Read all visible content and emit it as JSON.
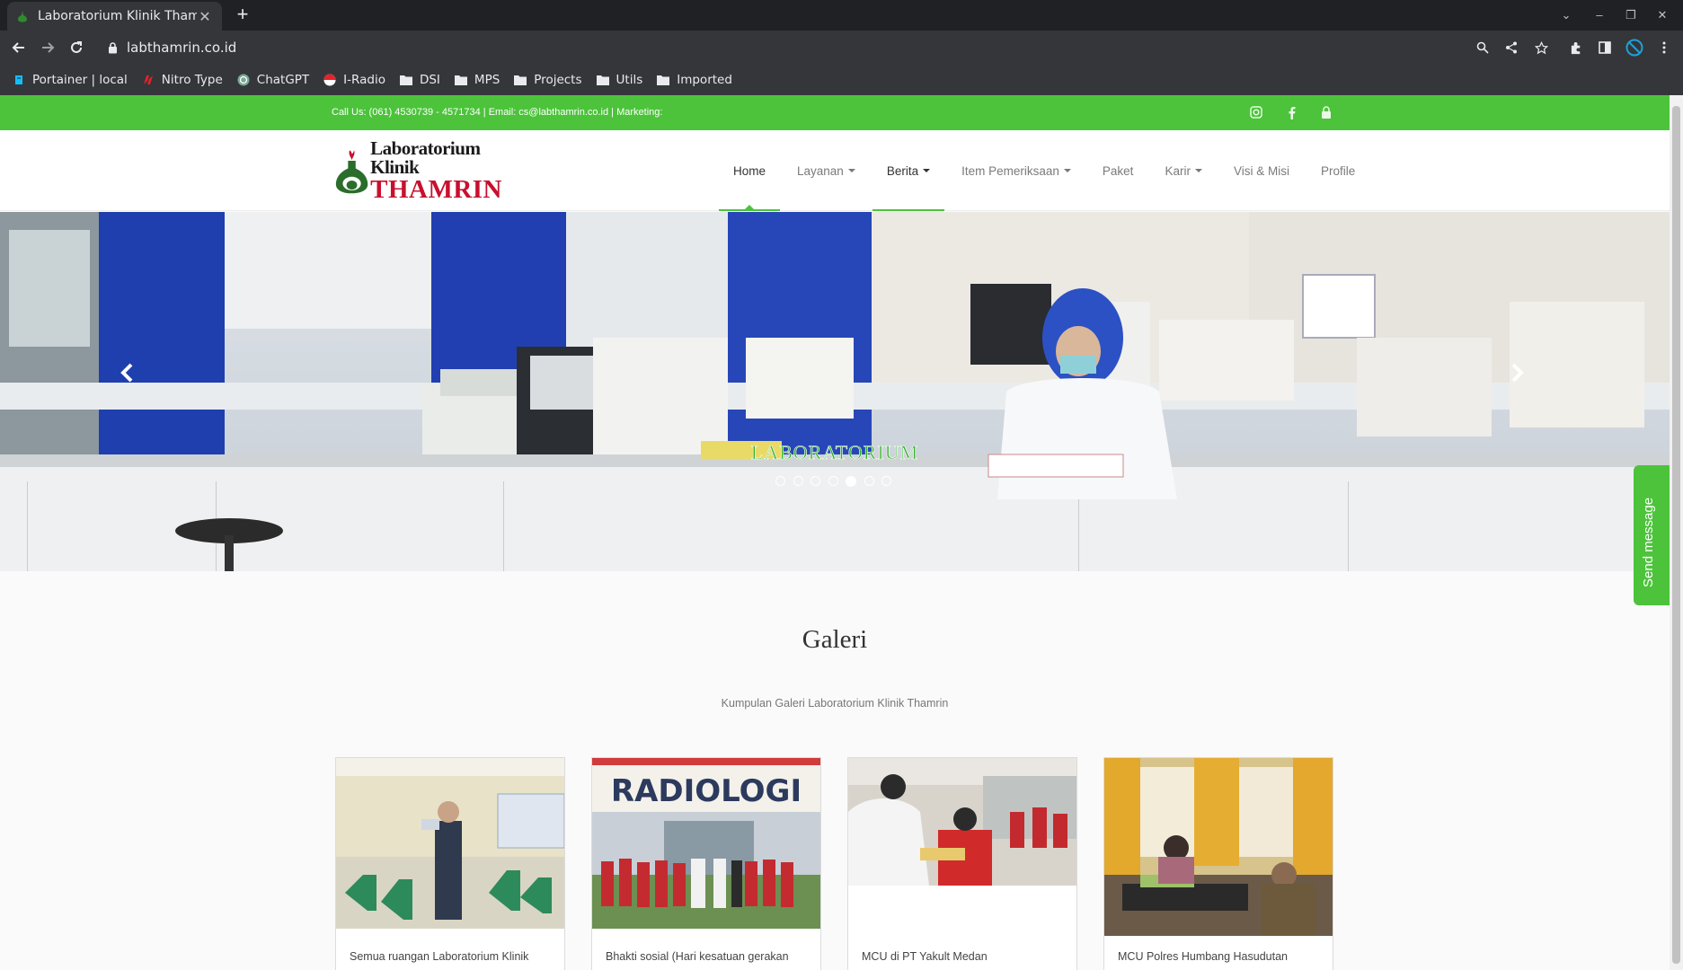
{
  "browser": {
    "tab_title": "Laboratorium Klinik Thamrin",
    "url": "labthamrin.co.id",
    "bookmarks": [
      {
        "label": "Portainer | local",
        "icon": "portainer-icon"
      },
      {
        "label": "Nitro Type",
        "icon": "nitro-type-icon"
      },
      {
        "label": "ChatGPT",
        "icon": "chatgpt-icon"
      },
      {
        "label": "I-Radio",
        "icon": "iradio-icon"
      },
      {
        "label": "DSI",
        "icon": "folder-icon"
      },
      {
        "label": "MPS",
        "icon": "folder-icon"
      },
      {
        "label": "Projects",
        "icon": "folder-icon"
      },
      {
        "label": "Utils",
        "icon": "folder-icon"
      },
      {
        "label": "Imported",
        "icon": "folder-icon"
      }
    ]
  },
  "topbar": {
    "contact": "Call Us: (061) 4530739 - 4571734 | Email: cs@labthamrin.co.id | Marketing:"
  },
  "logo": {
    "line1": "Laboratorium Klinik",
    "line2": "THAMRIN"
  },
  "nav": {
    "items": [
      {
        "label": "Home",
        "dropdown": false
      },
      {
        "label": "Layanan",
        "dropdown": true
      },
      {
        "label": "Berita",
        "dropdown": true
      },
      {
        "label": "Item Pemeriksaan",
        "dropdown": true
      },
      {
        "label": "Paket",
        "dropdown": false
      },
      {
        "label": "Karir",
        "dropdown": true
      },
      {
        "label": "Visi & Misi",
        "dropdown": false
      },
      {
        "label": "Profile",
        "dropdown": false
      }
    ]
  },
  "hero": {
    "caption": "LABORATORIUM",
    "slide_count": 7,
    "active_slide": 5
  },
  "send_message": "Send message",
  "gallery": {
    "title": "Galeri",
    "subtitle": "Kumpulan Galeri Laboratorium Klinik Thamrin",
    "items": [
      {
        "caption": "Semua ruangan Laboratorium Klinik"
      },
      {
        "caption": "Bhakti sosial (Hari kesatuan gerakan",
        "banner": "RADIOLOGI"
      },
      {
        "caption": "MCU di PT Yakult Medan"
      },
      {
        "caption": "MCU Polres Humbang Hasudutan"
      }
    ]
  },
  "colors": {
    "brand_green": "#4cc33b",
    "brand_red": "#c8102e"
  }
}
